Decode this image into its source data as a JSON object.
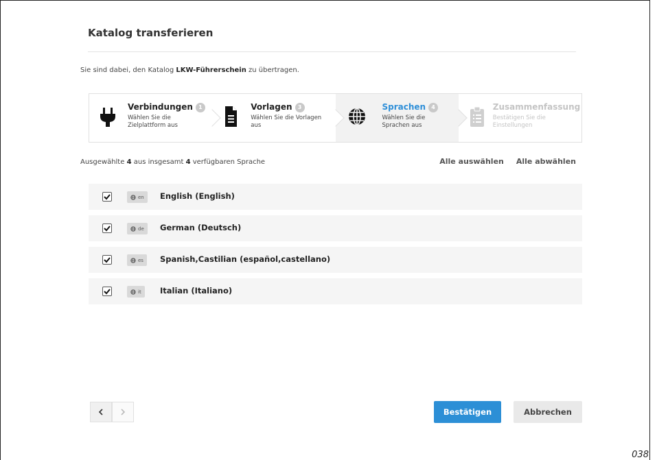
{
  "dialog": {
    "title": "Katalog transferieren",
    "intro_prefix": "Sie sind dabei, den Katalog ",
    "catalog_name": "LKW-Führerschein",
    "intro_suffix": " zu übertragen."
  },
  "steps": [
    {
      "title": "Verbindungen",
      "number": "1",
      "description": "Wählen Sie die Zielplattform aus",
      "icon": "plug-icon",
      "state": "done"
    },
    {
      "title": "Vorlagen",
      "number": "3",
      "description": "Wählen Sie die Vorlagen aus",
      "icon": "document-icon",
      "state": "done"
    },
    {
      "title": "Sprachen",
      "number": "4",
      "description": "Wählen Sie die Sprachen aus",
      "icon": "globe-icon",
      "state": "active"
    },
    {
      "title": "Zusammenfassung",
      "number": "",
      "description": "Bestätigen Sie die Einstellungen",
      "icon": "clipboard-list-icon",
      "state": "disabled"
    }
  ],
  "selection": {
    "prefix": "Ausgewählte ",
    "selected_count": "4",
    "middle": " aus insgesamt ",
    "total_count": "4",
    "suffix": " verfügbaren Sprache",
    "select_all": "Alle auswählen",
    "deselect_all": "Alle abwählen"
  },
  "languages": [
    {
      "code": "en",
      "name": "English (English)",
      "checked": true
    },
    {
      "code": "de",
      "name": "German (Deutsch)",
      "checked": true
    },
    {
      "code": "es",
      "name": "Spanish,Castilian (español,castellano)",
      "checked": true
    },
    {
      "code": "it",
      "name": "Italian (Italiano)",
      "checked": true
    }
  ],
  "footer": {
    "prev_icon": "chevron-left-icon",
    "next_icon": "chevron-right-icon",
    "confirm_label": "Bestätigen",
    "cancel_label": "Abbrechen"
  },
  "page_number": "038",
  "colors": {
    "accent": "#2c8fd6",
    "active_step_title": "#2f8fd8",
    "row_background": "#f5f5f5"
  }
}
